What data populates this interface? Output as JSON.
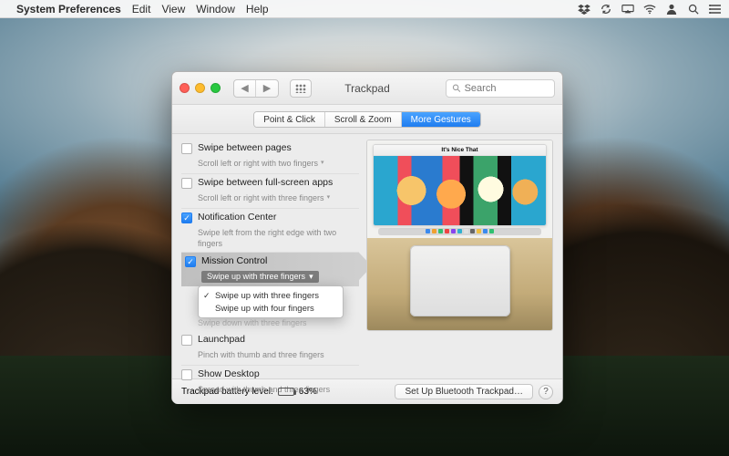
{
  "menubar": {
    "app_title": "System Preferences",
    "items": [
      "Edit",
      "View",
      "Window",
      "Help"
    ]
  },
  "window": {
    "title": "Trackpad",
    "search_placeholder": "Search",
    "tabs": [
      "Point & Click",
      "Scroll & Zoom",
      "More Gestures"
    ],
    "active_tab": 2
  },
  "options": [
    {
      "title": "Swipe between pages",
      "sub": "Scroll left or right with two fingers",
      "checked": false,
      "has_dropdown": true
    },
    {
      "title": "Swipe between full-screen apps",
      "sub": "Scroll left or right with three fingers",
      "checked": false,
      "has_dropdown": true
    },
    {
      "title": "Notification Center",
      "sub": "Swipe left from the right edge with two fingers",
      "checked": true,
      "has_dropdown": false
    },
    {
      "title": "Mission Control",
      "sub": "Swipe up with three fingers",
      "checked": true,
      "has_dropdown": true,
      "highlighted": true
    },
    {
      "title": "Launchpad",
      "sub": "Pinch with thumb and three fingers",
      "checked": false,
      "has_dropdown": false
    },
    {
      "title": "Show Desktop",
      "sub": "Spread with thumb and three fingers",
      "checked": false,
      "has_dropdown": false
    }
  ],
  "dropdown": {
    "selected": 0,
    "items": [
      "Swipe up with three fingers",
      "Swipe up with four fingers"
    ]
  },
  "obscured_hint": "Swipe down with three fingers",
  "preview": {
    "window_title": "It's Nice That"
  },
  "footer": {
    "battery_label": "Trackpad battery level:",
    "battery_pct_text": "63%",
    "battery_pct": 63,
    "setup_button": "Set Up Bluetooth Trackpad…",
    "help": "?"
  }
}
